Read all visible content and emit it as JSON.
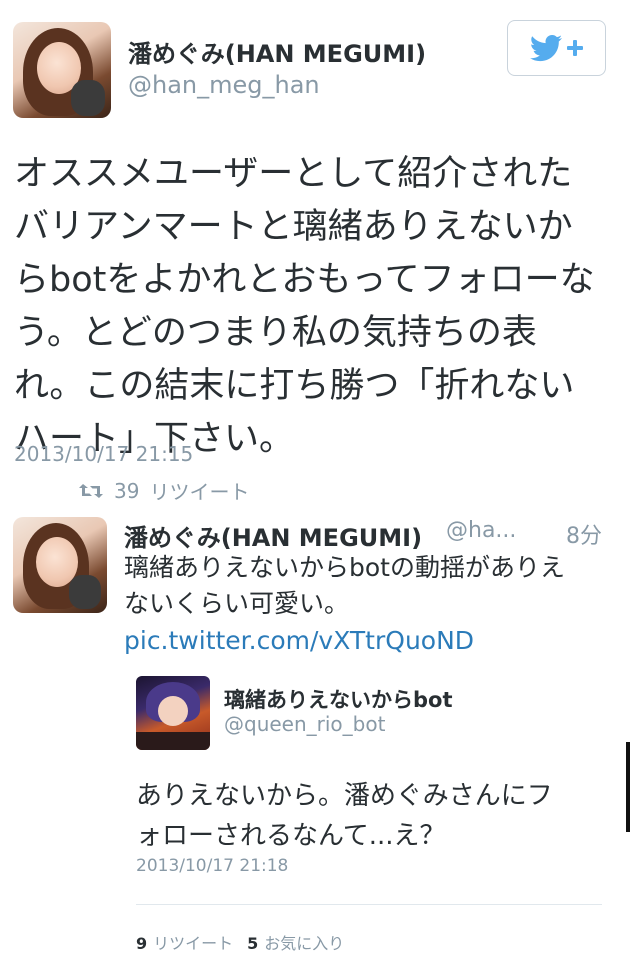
{
  "colors": {
    "twitter_blue": "#55acee",
    "link_blue": "#2b7bb9",
    "text": "#292f33",
    "muted": "#8899a6"
  },
  "main_tweet": {
    "author_name": "潘めぐみ(HAN MEGUMI)",
    "author_handle": "@han_meg_han",
    "follow_icon": "twitter-bird-plus-icon",
    "text_lines": [
      "オススメユーザーとして紹介された",
      "バリアンマートと璃緒ありえないか",
      "らbotをよかれとおもってフォローな",
      "う。とどのつまり私の気持ちの表",
      "れ。この結末に打ち勝つ「折れない",
      "ハート」下さい。"
    ],
    "timestamp": "2013/10/17 21:15",
    "retweet_icon": "retweet-icon",
    "retweet_count": "39",
    "retweet_label": "リツイート"
  },
  "reply_tweet": {
    "author_name": "潘めぐみ(HAN MEGUMI)",
    "author_handle": "@ha...",
    "time_ago": "8分",
    "text_lines": [
      "璃緒ありえないからbotの動揺がありえないくらい可愛い。"
    ],
    "line1": "璃緒ありえないからbotの動揺がありえ",
    "line2_prefix": "ないくらい可愛い。",
    "link": "pic.twitter.com/vXTtrQuoND"
  },
  "quoted_tweet": {
    "author_name": "璃緒ありえないからbot",
    "author_handle": "@queen_rio_bot",
    "text_line1": "ありえないから。潘めぐみさんにフ",
    "text_line2": "ォローされるなんて...え？",
    "timestamp": "2013/10/17 21:18",
    "retweets_count": "9",
    "retweets_label": "リツイート",
    "favorites_count": "5",
    "favorites_label": "お気に入り"
  }
}
